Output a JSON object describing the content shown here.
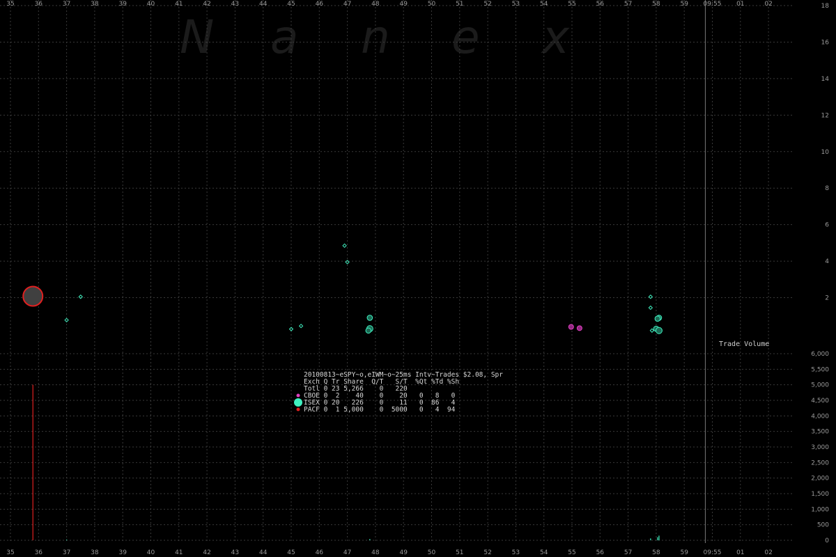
{
  "watermark": [
    "N",
    "a",
    "n",
    "e",
    "x"
  ],
  "colors": {
    "background": "#000000",
    "grid": "#3a3a3a",
    "cboe": "#e040c0",
    "isex": "#40f0c0",
    "pacf": "#e02020",
    "big_bubble_fill": "#404040"
  },
  "chart_data": [
    {
      "type": "scatter",
      "title": "20100813~eSPY~o,eIWM~o~25ms Intv~Trades $2.08, Spr",
      "x_tick_labels": [
        "35",
        "36",
        "37",
        "38",
        "39",
        "40",
        "41",
        "42",
        "43",
        "44",
        "45",
        "46",
        "47",
        "48",
        "49",
        "50",
        "51",
        "52",
        "53",
        "54",
        "55",
        "56",
        "57",
        "58",
        "59",
        "09:55",
        "01",
        "02"
      ],
      "x_range_seconds": [
        35,
        62
      ],
      "y_tick_labels": [
        "2",
        "4",
        "6",
        "8",
        "10",
        "12",
        "14",
        "16",
        "18"
      ],
      "ylim": [
        0,
        18
      ],
      "grid": true,
      "series": [
        {
          "name": "PACF",
          "color": "#e02020",
          "points": [
            {
              "x": 35.8,
              "y": 2.08,
              "size": 5000
            }
          ]
        },
        {
          "name": "CBOE",
          "color": "#e040c0",
          "points": [
            {
              "x": 54.97,
              "y": 0.4,
              "size": 20
            },
            {
              "x": 55.27,
              "y": 0.33,
              "size": 20
            }
          ]
        },
        {
          "name": "ISEX",
          "color": "#40f0c0",
          "points": [
            {
              "x": 37.0,
              "y": 0.77,
              "size": 5
            },
            {
              "x": 37.5,
              "y": 2.05,
              "size": 5
            },
            {
              "x": 45.0,
              "y": 0.28,
              "size": 5
            },
            {
              "x": 45.35,
              "y": 0.45,
              "size": 5
            },
            {
              "x": 46.9,
              "y": 4.85,
              "size": 5
            },
            {
              "x": 47.0,
              "y": 3.95,
              "size": 5
            },
            {
              "x": 47.8,
              "y": 0.9,
              "size": 12
            },
            {
              "x": 47.8,
              "y": 0.3,
              "size": 15
            },
            {
              "x": 47.75,
              "y": 0.2,
              "size": 12
            },
            {
              "x": 57.8,
              "y": 2.05,
              "size": 5
            },
            {
              "x": 57.8,
              "y": 1.45,
              "size": 5
            },
            {
              "x": 58.1,
              "y": 0.9,
              "size": 12
            },
            {
              "x": 58.05,
              "y": 0.85,
              "size": 12
            },
            {
              "x": 57.85,
              "y": 0.2,
              "size": 5
            },
            {
              "x": 58.0,
              "y": 0.3,
              "size": 12
            },
            {
              "x": 58.1,
              "y": 0.2,
              "size": 20
            }
          ]
        }
      ],
      "vertical_marker_x": 59.75
    },
    {
      "type": "bar",
      "ylabel": "Trade Volume",
      "y_tick_labels": [
        "0",
        "500",
        "1,000",
        "1,500",
        "2,000",
        "2,500",
        "3,000",
        "3,500",
        "4,000",
        "4,500",
        "5,000",
        "5,500",
        "6,000"
      ],
      "ylim": [
        0,
        6000
      ],
      "grid": true,
      "series": [
        {
          "name": "PACF",
          "color": "#e02020",
          "bars": [
            {
              "x": 35.8,
              "value": 5000
            }
          ]
        },
        {
          "name": "ISEX",
          "color": "#40f0c0",
          "bars": [
            {
              "x": 37.0,
              "value": 10
            },
            {
              "x": 47.8,
              "value": 40
            },
            {
              "x": 57.8,
              "value": 60
            },
            {
              "x": 58.05,
              "value": 100
            },
            {
              "x": 58.1,
              "value": 150
            }
          ]
        }
      ]
    }
  ],
  "stats_table": {
    "title": "20100813~eSPY~o,eIWM~o~25ms Intv~Trades $2.08, Spr",
    "header": "Exch Q Tr Share  Q/T   S/T  %Qt %Td %Sh",
    "total": "Totl 0 23 5,266    0   220",
    "rows": [
      {
        "exch": "CBOE",
        "color": "#e040c0",
        "text": "CBOE 0  2    40    0    20   0   8   0"
      },
      {
        "exch": "ISEX",
        "color": "#40f0c0",
        "text": "ISEX 0 20   226    0    11   0  86   4"
      },
      {
        "exch": "PACF",
        "color": "#e02020",
        "text": "PACF 0  1 5,000    0  5000   0   4  94"
      }
    ]
  }
}
